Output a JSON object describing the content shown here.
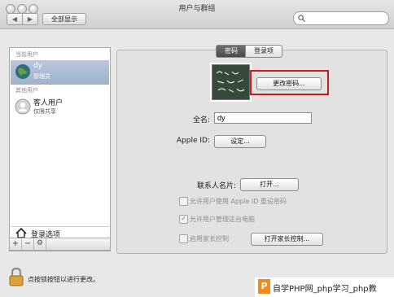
{
  "window": {
    "title": "用户与群组"
  },
  "toolbar": {
    "back_icon": "back-arrow-icon",
    "forward_icon": "forward-arrow-icon",
    "show_all_label": "全部显示",
    "search_placeholder": ""
  },
  "sidebar": {
    "current_users_header": "当前用户",
    "current_user": {
      "name": "dy",
      "role": "管理员"
    },
    "other_users_header": "其他用户",
    "other_user": {
      "name": "客人用户",
      "role": "仅限共享"
    },
    "login_options_label": "登录选项",
    "add_label": "+",
    "remove_label": "−",
    "gear_label": "⚙"
  },
  "tabs": {
    "password": "密码",
    "login_items": "登录项"
  },
  "account": {
    "change_password_label": "更改密码...",
    "full_name_label": "全名:",
    "full_name_value": "dy",
    "apple_id_label": "Apple ID:",
    "apple_id_button": "设定...",
    "contact_card_label": "联系人名片:",
    "contact_card_button": "打开...",
    "allow_reset_label": "允许用户使用 Apple ID 重设密码",
    "allow_admin_label": "允许用户管理这台电脑",
    "allow_admin_checked": "✓",
    "parental_label": "启用家长控制",
    "parental_button": "打开家长控制..."
  },
  "footer": {
    "lock_text": "点按锁按钮以进行更改。"
  },
  "watermark": {
    "icon_letter": "P",
    "text": "自学PHP网_php学习_php教"
  }
}
